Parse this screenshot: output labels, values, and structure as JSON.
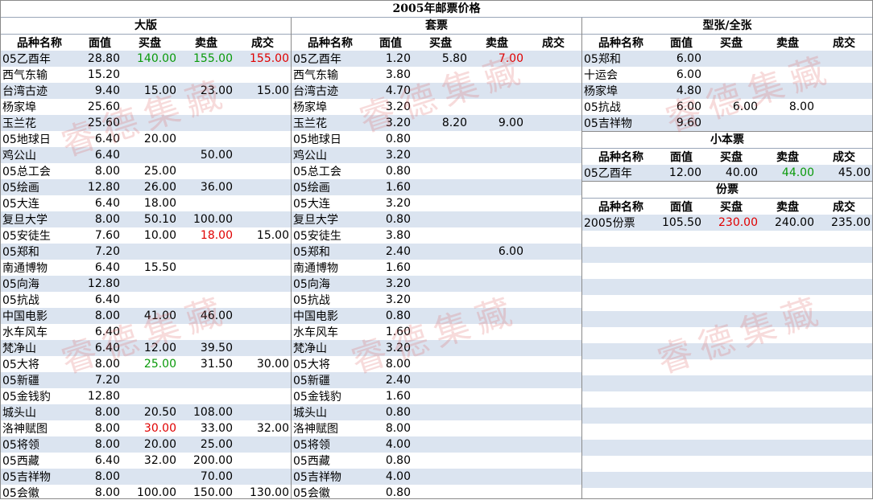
{
  "title": "2005年邮票价格",
  "headers": [
    "品种名称",
    "面值",
    "买盘",
    "卖盘",
    "成交"
  ],
  "watermark": "睿德集藏",
  "colors": {
    "alt_row": "#dbe4f0",
    "green": "#0a9a0a",
    "red": "#e00000"
  },
  "left": {
    "title": "大版",
    "rows": [
      {
        "name": "05乙酉年",
        "face": "28.80",
        "buy": "140.00",
        "sell": "155.00",
        "deal": "155.00",
        "buy_color": "green",
        "sell_color": "green",
        "deal_color": "red"
      },
      {
        "name": "西气东输",
        "face": "15.20",
        "buy": "",
        "sell": "",
        "deal": ""
      },
      {
        "name": "台湾古迹",
        "face": "9.40",
        "buy": "15.00",
        "sell": "23.00",
        "deal": "15.00"
      },
      {
        "name": "杨家埠",
        "face": "25.60",
        "buy": "",
        "sell": "",
        "deal": ""
      },
      {
        "name": "玉兰花",
        "face": "25.60",
        "buy": "",
        "sell": "",
        "deal": ""
      },
      {
        "name": "05地球日",
        "face": "6.40",
        "buy": "20.00",
        "sell": "",
        "deal": ""
      },
      {
        "name": "鸡公山",
        "face": "6.40",
        "buy": "",
        "sell": "50.00",
        "deal": ""
      },
      {
        "name": "05总工会",
        "face": "8.00",
        "buy": "25.00",
        "sell": "",
        "deal": ""
      },
      {
        "name": "05绘画",
        "face": "12.80",
        "buy": "26.00",
        "sell": "36.00",
        "deal": ""
      },
      {
        "name": "05大连",
        "face": "6.40",
        "buy": "18.00",
        "sell": "",
        "deal": ""
      },
      {
        "name": "复旦大学",
        "face": "8.00",
        "buy": "50.10",
        "sell": "100.00",
        "deal": ""
      },
      {
        "name": "05安徒生",
        "face": "7.60",
        "buy": "10.00",
        "sell": "18.00",
        "deal": "15.00",
        "sell_color": "red"
      },
      {
        "name": "05郑和",
        "face": "7.20",
        "buy": "",
        "sell": "",
        "deal": ""
      },
      {
        "name": "南通博物",
        "face": "6.40",
        "buy": "15.50",
        "sell": "",
        "deal": ""
      },
      {
        "name": "05向海",
        "face": "12.80",
        "buy": "",
        "sell": "",
        "deal": ""
      },
      {
        "name": "05抗战",
        "face": "6.40",
        "buy": "",
        "sell": "",
        "deal": ""
      },
      {
        "name": "中国电影",
        "face": "8.00",
        "buy": "41.00",
        "sell": "46.00",
        "deal": ""
      },
      {
        "name": "水车风车",
        "face": "6.40",
        "buy": "",
        "sell": "",
        "deal": ""
      },
      {
        "name": "梵净山",
        "face": "6.40",
        "buy": "12.00",
        "sell": "39.50",
        "deal": ""
      },
      {
        "name": "05大将",
        "face": "8.00",
        "buy": "25.00",
        "sell": "31.50",
        "deal": "30.00",
        "buy_color": "green"
      },
      {
        "name": "05新疆",
        "face": "7.20",
        "buy": "",
        "sell": "",
        "deal": ""
      },
      {
        "name": "05金钱豹",
        "face": "12.80",
        "buy": "",
        "sell": "",
        "deal": ""
      },
      {
        "name": "城头山",
        "face": "8.00",
        "buy": "20.50",
        "sell": "108.00",
        "deal": ""
      },
      {
        "name": "洛神赋图",
        "face": "8.00",
        "buy": "30.00",
        "sell": "33.00",
        "deal": "32.00",
        "buy_color": "red"
      },
      {
        "name": "05将领",
        "face": "8.00",
        "buy": "20.00",
        "sell": "25.00",
        "deal": ""
      },
      {
        "name": "05西藏",
        "face": "6.40",
        "buy": "32.00",
        "sell": "200.00",
        "deal": ""
      },
      {
        "name": "05吉祥物",
        "face": "8.00",
        "buy": "",
        "sell": "70.00",
        "deal": ""
      },
      {
        "name": "05会徽",
        "face": "8.00",
        "buy": "100.00",
        "sell": "150.00",
        "deal": "130.00"
      }
    ]
  },
  "middle": {
    "title": "套票",
    "rows": [
      {
        "name": "05乙酉年",
        "face": "1.20",
        "buy": "5.80",
        "sell": "7.00",
        "deal": "",
        "sell_color": "red"
      },
      {
        "name": "西气东输",
        "face": "3.80",
        "buy": "",
        "sell": "",
        "deal": ""
      },
      {
        "name": "台湾古迹",
        "face": "4.70",
        "buy": "",
        "sell": "",
        "deal": ""
      },
      {
        "name": "杨家埠",
        "face": "3.20",
        "buy": "",
        "sell": "",
        "deal": ""
      },
      {
        "name": "玉兰花",
        "face": "3.20",
        "buy": "8.20",
        "sell": "9.00",
        "deal": ""
      },
      {
        "name": "05地球日",
        "face": "0.80",
        "buy": "",
        "sell": "",
        "deal": ""
      },
      {
        "name": "鸡公山",
        "face": "3.20",
        "buy": "",
        "sell": "",
        "deal": ""
      },
      {
        "name": "05总工会",
        "face": "0.80",
        "buy": "",
        "sell": "",
        "deal": ""
      },
      {
        "name": "05绘画",
        "face": "1.60",
        "buy": "",
        "sell": "",
        "deal": ""
      },
      {
        "name": "05大连",
        "face": "3.20",
        "buy": "",
        "sell": "",
        "deal": ""
      },
      {
        "name": "复旦大学",
        "face": "0.80",
        "buy": "",
        "sell": "",
        "deal": ""
      },
      {
        "name": "05安徒生",
        "face": "3.80",
        "buy": "",
        "sell": "",
        "deal": ""
      },
      {
        "name": "05郑和",
        "face": "2.40",
        "buy": "",
        "sell": "6.00",
        "deal": ""
      },
      {
        "name": "南通博物",
        "face": "1.60",
        "buy": "",
        "sell": "",
        "deal": ""
      },
      {
        "name": "05向海",
        "face": "3.20",
        "buy": "",
        "sell": "",
        "deal": ""
      },
      {
        "name": "05抗战",
        "face": "3.20",
        "buy": "",
        "sell": "",
        "deal": ""
      },
      {
        "name": "中国电影",
        "face": "0.80",
        "buy": "",
        "sell": "",
        "deal": ""
      },
      {
        "name": "水车风车",
        "face": "1.60",
        "buy": "",
        "sell": "",
        "deal": ""
      },
      {
        "name": "梵净山",
        "face": "3.20",
        "buy": "",
        "sell": "",
        "deal": ""
      },
      {
        "name": "05大将",
        "face": "8.00",
        "buy": "",
        "sell": "",
        "deal": ""
      },
      {
        "name": "05新疆",
        "face": "2.40",
        "buy": "",
        "sell": "",
        "deal": ""
      },
      {
        "name": "05金钱豹",
        "face": "1.60",
        "buy": "",
        "sell": "",
        "deal": ""
      },
      {
        "name": "城头山",
        "face": "0.80",
        "buy": "",
        "sell": "",
        "deal": ""
      },
      {
        "name": "洛神赋图",
        "face": "8.00",
        "buy": "",
        "sell": "",
        "deal": ""
      },
      {
        "name": "05将领",
        "face": "4.00",
        "buy": "",
        "sell": "",
        "deal": ""
      },
      {
        "name": "05西藏",
        "face": "0.80",
        "buy": "",
        "sell": "",
        "deal": ""
      },
      {
        "name": "05吉祥物",
        "face": "4.00",
        "buy": "",
        "sell": "",
        "deal": ""
      },
      {
        "name": "05会徽",
        "face": "0.80",
        "buy": "",
        "sell": "",
        "deal": ""
      }
    ]
  },
  "right": {
    "sections": [
      {
        "title": "型张/全张",
        "rows": [
          {
            "name": "05郑和",
            "face": "6.00",
            "buy": "",
            "sell": "",
            "deal": ""
          },
          {
            "name": "十运会",
            "face": "6.00",
            "buy": "",
            "sell": "",
            "deal": ""
          },
          {
            "name": "杨家埠",
            "face": "4.80",
            "buy": "",
            "sell": "",
            "deal": ""
          },
          {
            "name": "05抗战",
            "face": "6.00",
            "buy": "6.00",
            "sell": "8.00",
            "deal": ""
          },
          {
            "name": "05吉祥物",
            "face": "9.60",
            "buy": "",
            "sell": "",
            "deal": ""
          }
        ]
      },
      {
        "title": "小本票",
        "rows": [
          {
            "name": "05乙酉年",
            "face": "12.00",
            "buy": "40.00",
            "sell": "44.00",
            "deal": "45.00",
            "sell_color": "green"
          }
        ]
      },
      {
        "title": "份票",
        "rows": [
          {
            "name": "2005份票",
            "face": "105.50",
            "buy": "230.00",
            "sell": "240.00",
            "deal": "235.00",
            "buy_color": "red"
          }
        ]
      }
    ],
    "filler_rows": 17
  }
}
